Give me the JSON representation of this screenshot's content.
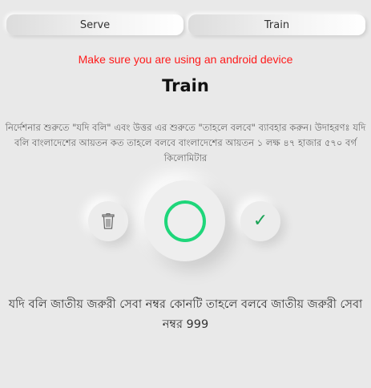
{
  "tabs": {
    "serve_label": "Serve",
    "train_label": "Train"
  },
  "warning": "Make sure you are using an android device",
  "title": "Train",
  "instructions": "নির্দেশনার শুরুতে \"যদি বলি\" এবং উত্তর এর শুরুতে \"তাহলে বলবে\" ব্যাবহার করুন। উদাহরণঃ যদি বলি বাংলাদেশের আয়তন কত তাহলে বলবে বাংলাদেশের আয়তন ১ লক্ষ ৪৭ হাজার ৫৭০ বর্গ কিলোমিটার",
  "controls": {
    "delete_icon": "trash-icon",
    "record_icon": "record-ring-icon",
    "confirm_icon": "checkmark-icon",
    "record_color": "#1ed67a",
    "check_color": "#1aa356"
  },
  "transcript": "যদি বলি জাতীয় জরুরী সেবা নম্বর কোনটি তাহলে বলবে জাতীয় জরুরী সেবা নম্বর 999"
}
